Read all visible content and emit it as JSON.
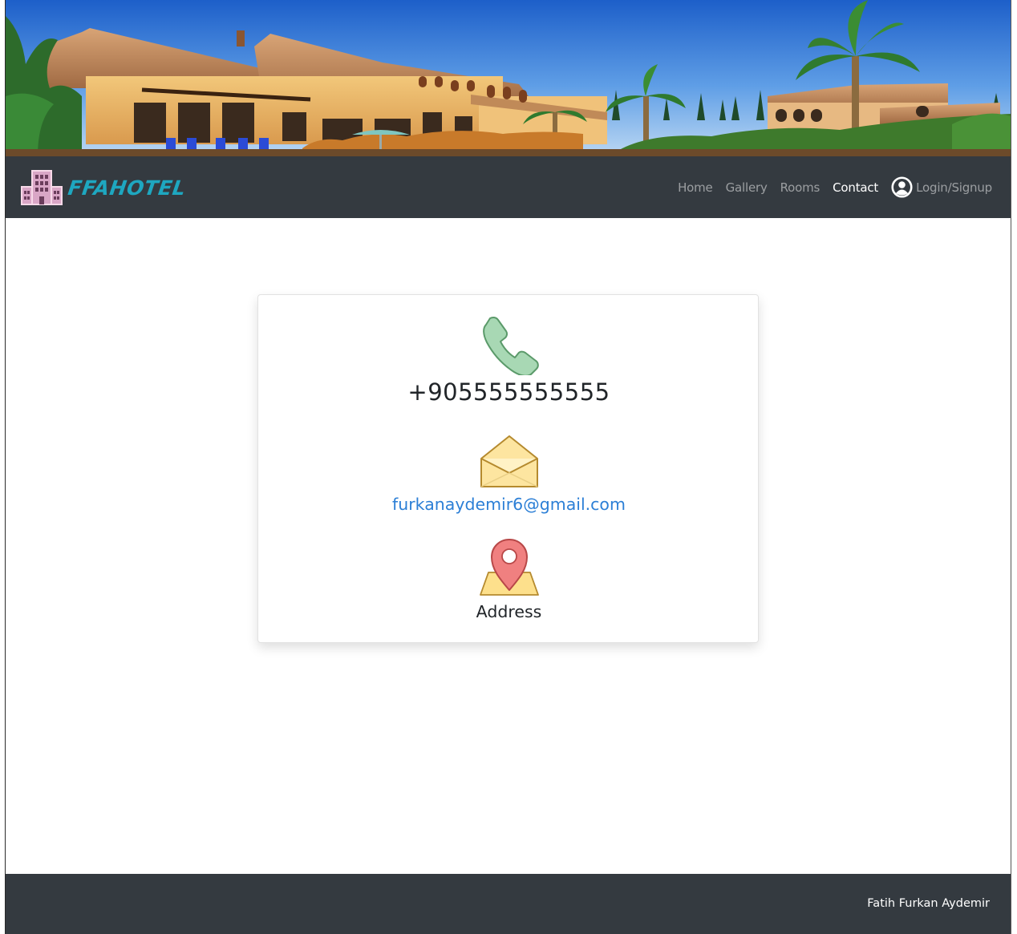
{
  "brand": {
    "name": "FFAHOTEL",
    "icon": "hotel-building-icon",
    "color": "#1ea7c0"
  },
  "nav": {
    "items": [
      {
        "label": "Home",
        "active": false
      },
      {
        "label": "Gallery",
        "active": false
      },
      {
        "label": "Rooms",
        "active": false
      },
      {
        "label": "Contact",
        "active": true
      },
      {
        "label": "Login/Signup",
        "active": false,
        "icon": "user-circle-icon"
      }
    ]
  },
  "contact": {
    "phone": {
      "icon": "phone-icon",
      "text": "+905555555555"
    },
    "email": {
      "icon": "envelope-icon",
      "text": "furkanaydemir6@gmail.com"
    },
    "address": {
      "icon": "map-pin-icon",
      "text": "Address"
    }
  },
  "footer": {
    "text": "Fatih Furkan Aydemir"
  },
  "colors": {
    "navbar": "#343a40",
    "link": "#2c7fd6",
    "phone_icon": "#a8d8b4",
    "envelope_icon": "#fde5a0",
    "pin_icon": "#f08080"
  }
}
